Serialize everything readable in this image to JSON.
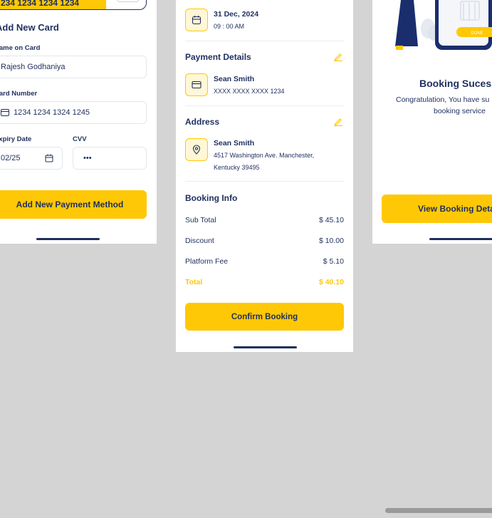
{
  "left_screen": {
    "card_number_partial": "234 1234 1234 1234",
    "section_title": "Add New Card",
    "name_label": "Name on Card",
    "name_value": "Rajesh Godhaniya",
    "card_label": "Card Number",
    "card_value": "1234 1234 1324 1245",
    "expiry_label": "Expiry Date",
    "expiry_value": "02/25",
    "cvv_label": "CVV",
    "cvv_value": "•••",
    "add_button": "Add New Payment Method"
  },
  "middle_screen": {
    "date": "31 Dec, 2024",
    "time": "09 : 00 AM",
    "payment_title": "Payment Details",
    "payment_name": "Sean Smith",
    "payment_card": "XXXX XXXX XXXX 1234",
    "address_title": "Address",
    "address_name": "Sean Smith",
    "address_line1": "4517 Washington Ave. Manchester,",
    "address_line2": "Kentucky 39495",
    "booking_info_title": "Booking Info",
    "rows": [
      {
        "label": "Sub Total",
        "value": "$ 45.10"
      },
      {
        "label": "Discount",
        "value": "$ 10.00"
      },
      {
        "label": "Platform Fee",
        "value": "$ 5.10"
      }
    ],
    "total_label": "Total",
    "total_value": "$ 40.10",
    "confirm_button": "Confirm Booking"
  },
  "right_screen": {
    "title": "Booking Sucess",
    "message_line1": "Congratulation, You have su",
    "message_line2": "booking service",
    "view_button": "View Booking Deta",
    "phone_button": "DONE"
  },
  "colors": {
    "accent": "#ffc806",
    "navy": "#1f2f5e",
    "background": "#d4d4d4"
  }
}
